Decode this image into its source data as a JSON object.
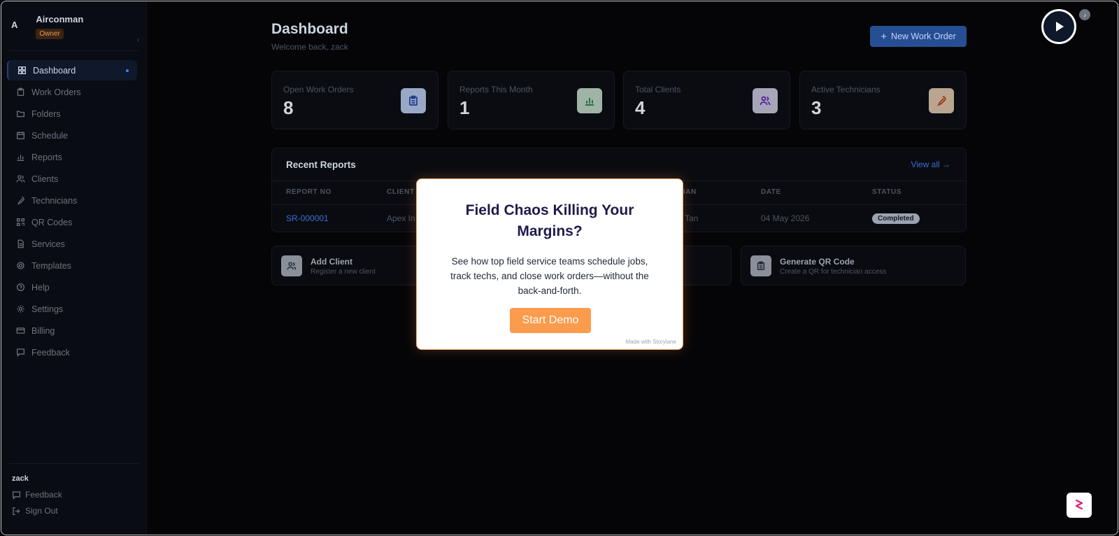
{
  "sidebar": {
    "brand_letter": "A",
    "company": "Airconman",
    "role": "Owner",
    "items": [
      {
        "label": "Dashboard",
        "icon": "grid-icon",
        "active": true
      },
      {
        "label": "Work Orders",
        "icon": "clipboard-icon"
      },
      {
        "label": "Folders",
        "icon": "folder-icon"
      },
      {
        "label": "Schedule",
        "icon": "calendar-icon"
      },
      {
        "label": "Reports",
        "icon": "bar-chart-icon"
      },
      {
        "label": "Clients",
        "icon": "users-icon"
      },
      {
        "label": "Technicians",
        "icon": "wrench-icon"
      },
      {
        "label": "QR Codes",
        "icon": "qr-code-icon"
      },
      {
        "label": "Services",
        "icon": "document-icon"
      },
      {
        "label": "Templates",
        "icon": "settings-gear-icon"
      },
      {
        "label": "Help",
        "icon": "help-circle-icon"
      },
      {
        "label": "Settings",
        "icon": "gear-icon"
      },
      {
        "label": "Billing",
        "icon": "credit-card-icon"
      },
      {
        "label": "Feedback",
        "icon": "message-icon"
      }
    ],
    "user": "zack",
    "footer_feedback": "Feedback",
    "sign_out": "Sign Out"
  },
  "header": {
    "title": "Dashboard",
    "subtitle": "Welcome back, zack",
    "new_button": "New Work Order"
  },
  "stats": [
    {
      "label": "Open Work Orders",
      "value": "8",
      "icon": "clipboard-icon",
      "icon_bg": "#9aa8c7",
      "icon_color": "#1e3a8a"
    },
    {
      "label": "Reports This Month",
      "value": "1",
      "icon": "bar-chart-icon",
      "icon_bg": "#9fb4a6",
      "icon_color": "#166534"
    },
    {
      "label": "Total Clients",
      "value": "4",
      "icon": "users-icon",
      "icon_bg": "#a7a5b8",
      "icon_color": "#4c1d95"
    },
    {
      "label": "Active Technicians",
      "value": "3",
      "icon": "wrench-icon",
      "icon_bg": "#b9a590",
      "icon_color": "#9a3412"
    }
  ],
  "recent_reports": {
    "title": "Recent Reports",
    "view_all": "View all →",
    "columns": [
      "REPORT NO",
      "CLIENT",
      "CIAN",
      "DATE",
      "STATUS"
    ],
    "row": {
      "report_no": "SR-000001",
      "client": "Apex In",
      "technician": "Tan",
      "date": "04 May 2026",
      "status": "Completed"
    }
  },
  "quick_actions": [
    {
      "title": "Add Client",
      "subtitle": "Register a new client",
      "icon": "users-icon"
    },
    {
      "title": "Generate QR Code",
      "subtitle": "Create a QR for technician access",
      "icon": "clipboard-icon"
    }
  ],
  "modal": {
    "title": "Field Chaos Killing Your Margins?",
    "body": "See how top field service teams schedule jobs, track techs, and close work orders—without the back-and-forth.",
    "cta": "Start Demo",
    "made_with": "Made with Storylane"
  }
}
